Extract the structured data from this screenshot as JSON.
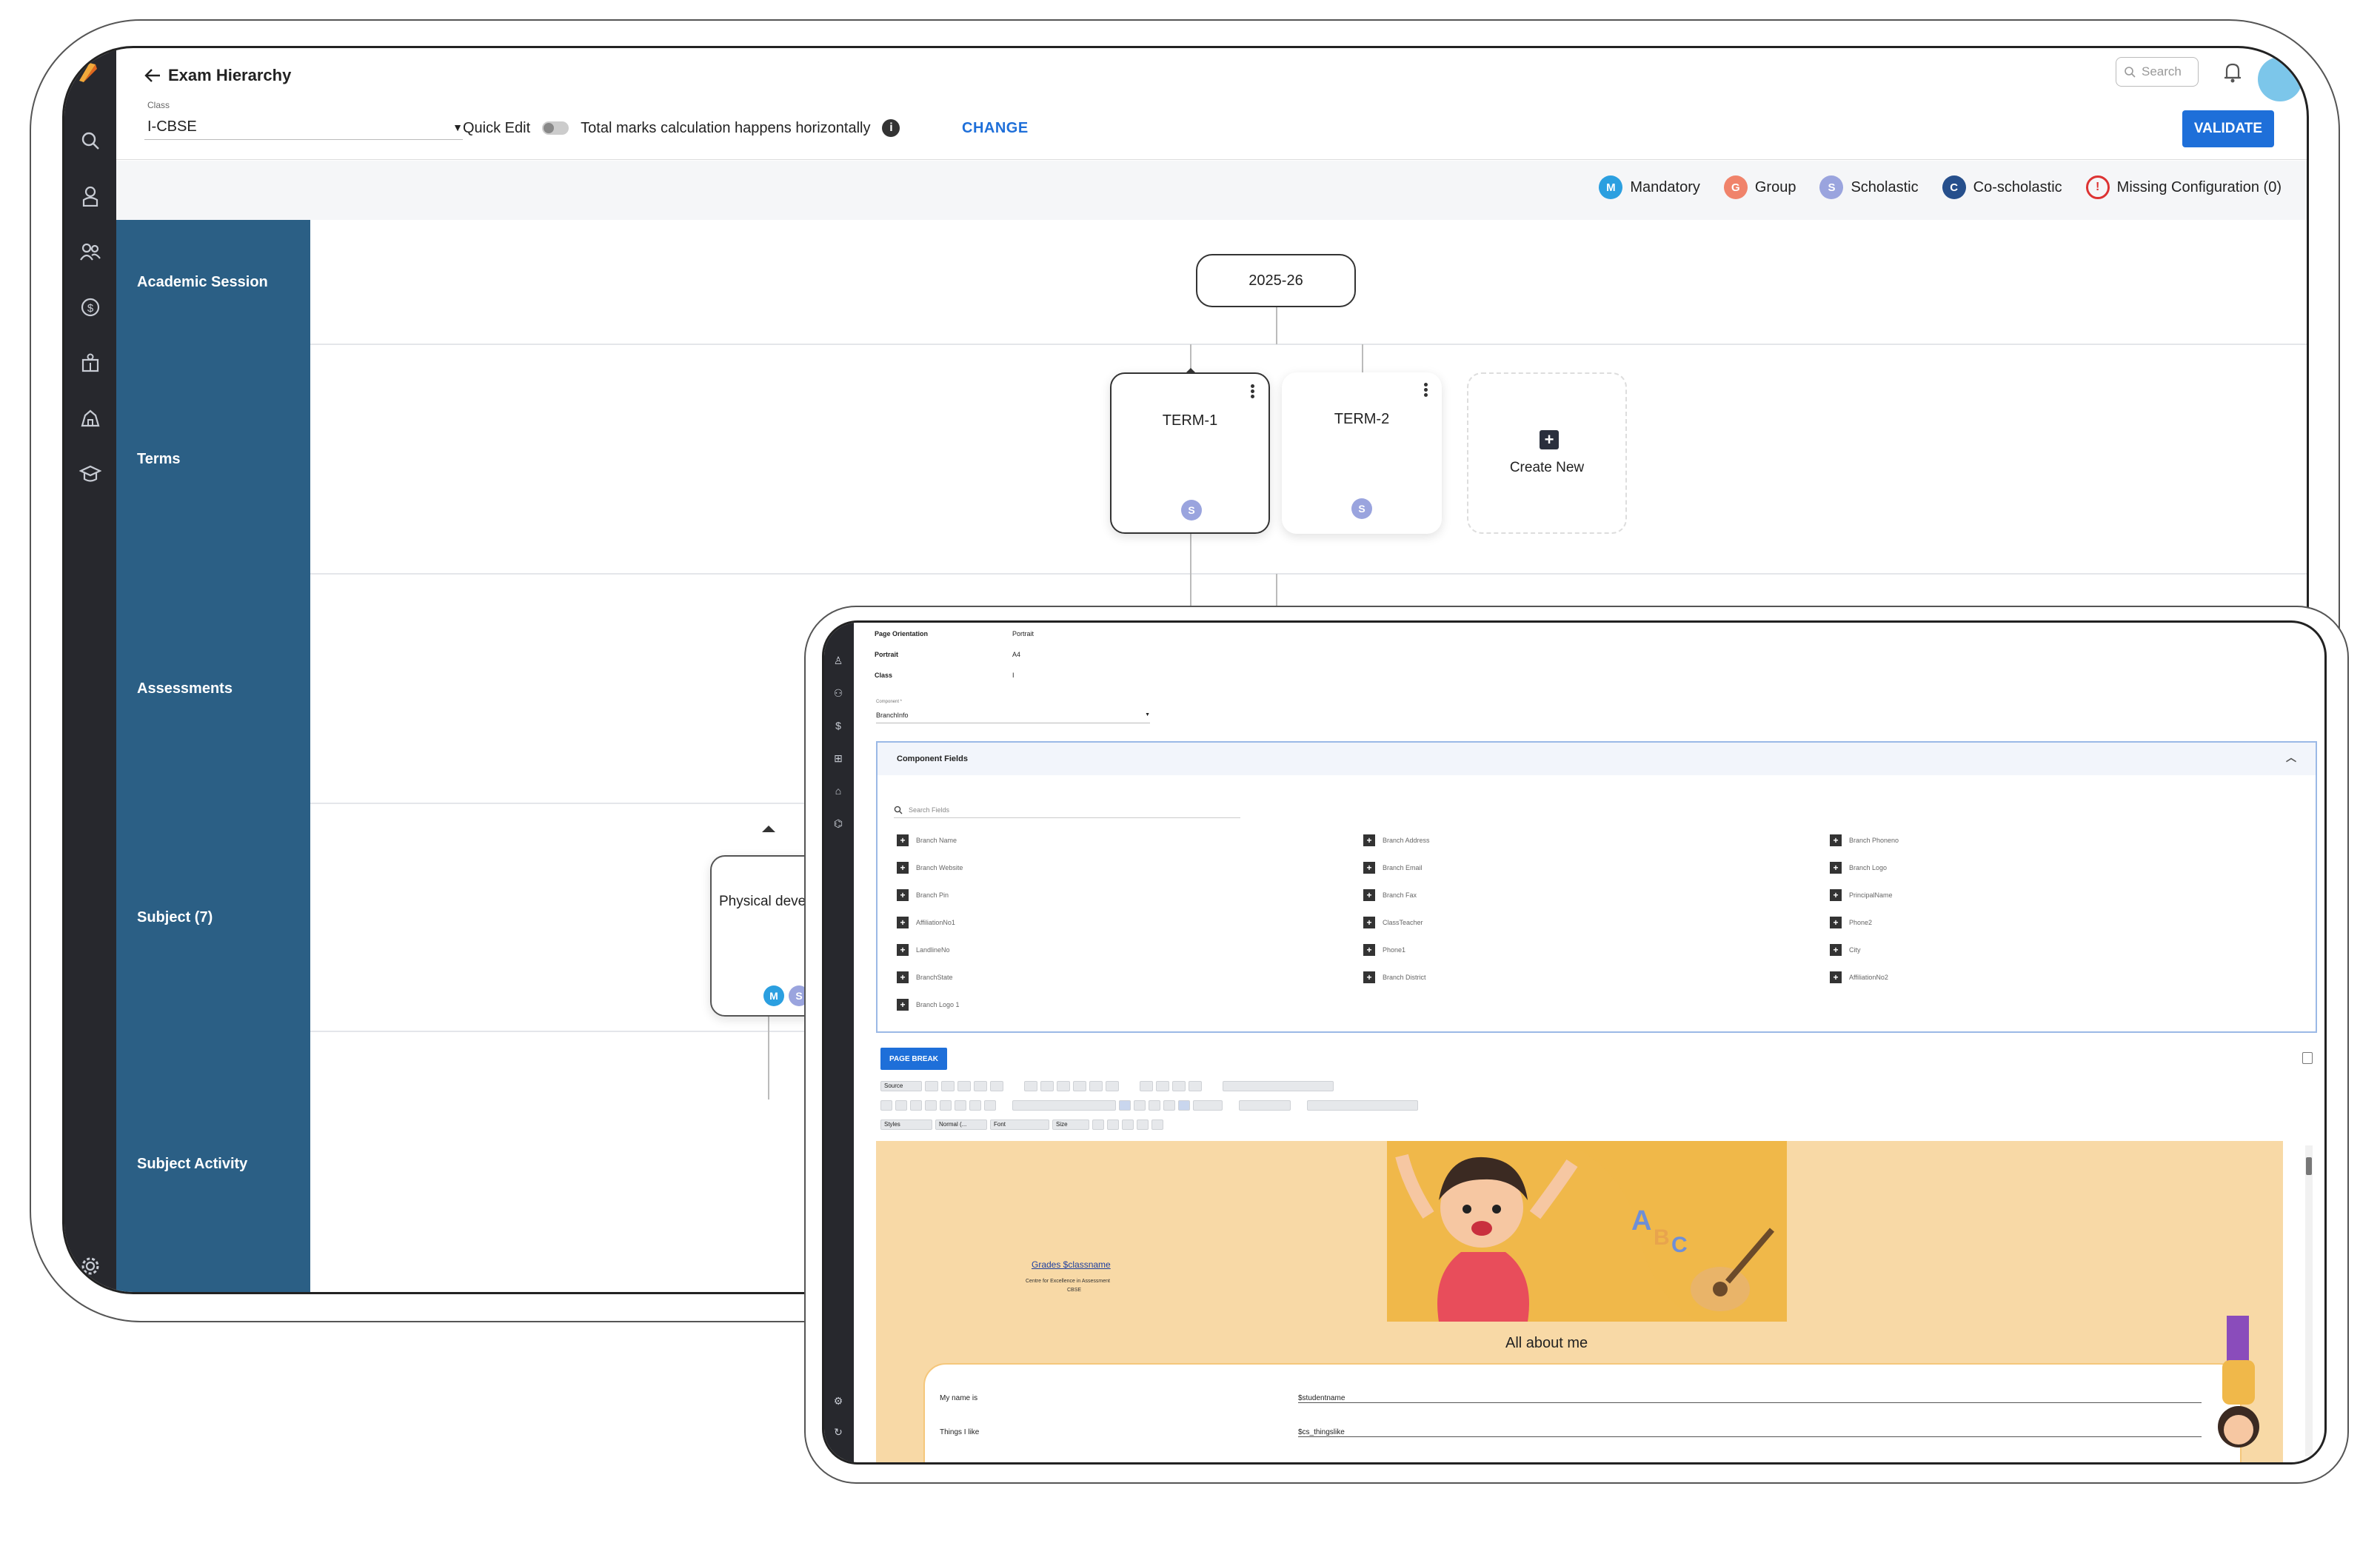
{
  "back": {
    "header": {
      "title": "Exam Hierarchy",
      "class_label": "Class",
      "class_value": "I-CBSE",
      "quick_edit": "Quick Edit",
      "total_marks_note": "Total marks calculation happens horizontally",
      "change": "CHANGE",
      "search_placeholder": "Search",
      "validate": "VALIDATE"
    },
    "legend": [
      {
        "letter": "M",
        "label": "Mandatory",
        "color": "#2b9fe0"
      },
      {
        "letter": "G",
        "label": "Group",
        "color": "#f0836b"
      },
      {
        "letter": "S",
        "label": "Scholastic",
        "color": "#9aa4de"
      },
      {
        "letter": "C",
        "label": "Co-scholastic",
        "color": "#264f8c"
      },
      {
        "letter": "!",
        "label": "Missing Configuration (0)",
        "color": "#d33333"
      }
    ],
    "rows": [
      "Academic Session",
      "Terms",
      "Assessments",
      "Subject (7)",
      "Subject Activity"
    ],
    "session_node": "2025-26",
    "terms": [
      {
        "label": "TERM-1",
        "badge": "S"
      },
      {
        "label": "TERM-2",
        "badge": "S"
      }
    ],
    "create_new": "Create New",
    "subject_card": {
      "label": "Physical develop",
      "badges": [
        "M",
        "S"
      ]
    }
  },
  "front": {
    "meta": [
      {
        "key": "Page Orientation",
        "value": "Portrait"
      },
      {
        "key": "Portrait",
        "value": "A4"
      },
      {
        "key": "Class",
        "value": "I"
      }
    ],
    "component_label": "Component *",
    "component_value": "BranchInfo",
    "component_fields_title": "Component Fields",
    "search_fields_placeholder": "Search Fields",
    "fields_col1": [
      "Branch Name",
      "Branch Website",
      "Branch Pin",
      "AffiliationNo1",
      "LandlineNo",
      "BranchState",
      "Branch Logo 1"
    ],
    "fields_col2": [
      "Branch Address",
      "Branch Email",
      "Branch Fax",
      "ClassTeacher",
      "Phone1",
      "Branch District"
    ],
    "fields_col3": [
      "Branch Phoneno",
      "Branch Logo",
      "PrincipalName",
      "Phone2",
      "City",
      "AffiliationNo2"
    ],
    "page_break": "PAGE BREAK",
    "toolbar_row1": [
      "Source"
    ],
    "toolbar_row3": [
      "Styles",
      "Normal (...",
      "Font",
      "Size"
    ],
    "editor": {
      "grade_link": "Grades $classname",
      "centre": "Centre for Excellence in Assessment",
      "board": "CBSE",
      "about_title": "All about me",
      "rows": [
        {
          "label": "My name is",
          "value": "$studentname"
        },
        {
          "label": "Things I like",
          "value": "$cs_thingslike"
        }
      ]
    }
  }
}
